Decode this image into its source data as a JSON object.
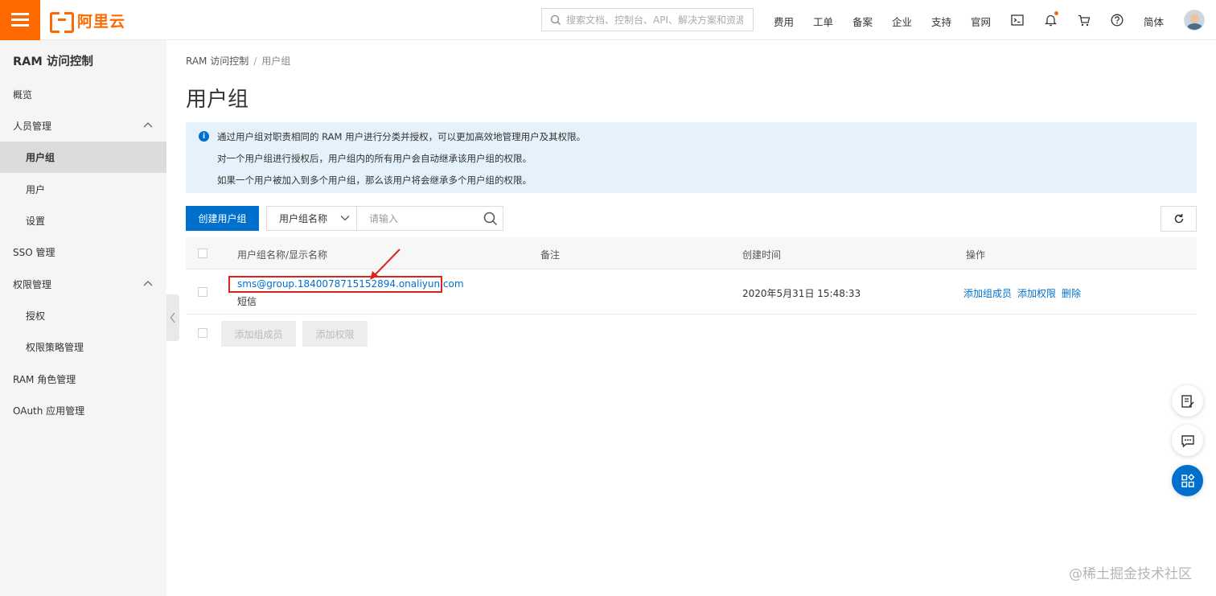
{
  "topbar": {
    "logo_text": "阿里云",
    "search_placeholder": "搜索文档、控制台、API、解决方案和资源",
    "nav": [
      "费用",
      "工单",
      "备案",
      "企业",
      "支持",
      "官网"
    ],
    "language": "简体",
    "accent_color": "#ff6a00"
  },
  "sidebar": {
    "title": "RAM 访问控制",
    "items": [
      {
        "label": "概览"
      },
      {
        "label": "人员管理"
      },
      {
        "label": "用户组"
      },
      {
        "label": "用户"
      },
      {
        "label": "设置"
      },
      {
        "label": "SSO 管理"
      },
      {
        "label": "权限管理"
      },
      {
        "label": "授权"
      },
      {
        "label": "权限策略管理"
      },
      {
        "label": "RAM 角色管理"
      },
      {
        "label": "OAuth 应用管理"
      }
    ]
  },
  "breadcrumb": {
    "root": "RAM 访问控制",
    "sep": "/",
    "current": "用户组"
  },
  "page_title": "用户组",
  "notice": {
    "lines": [
      "通过用户组对职责相同的 RAM 用户进行分类并授权，可以更加高效地管理用户及其权限。",
      "对一个用户组进行授权后，用户组内的所有用户会自动继承该用户组的权限。",
      "如果一个用户被加入到多个用户组，那么该用户将会继承多个用户组的权限。"
    ]
  },
  "toolbar": {
    "create_label": "创建用户组",
    "filter_field": "用户组名称",
    "filter_placeholder": "请输入"
  },
  "table": {
    "columns": [
      "用户组名称/显示名称",
      "备注",
      "创建时间",
      "操作"
    ],
    "rows": [
      {
        "name": "sms@group.1840078715152894.onaliyun.com",
        "display_name": "短信",
        "remark": "",
        "created": "2020年5月31日 15:48:33",
        "actions": [
          "添加组成员",
          "添加权限",
          "删除"
        ]
      }
    ],
    "batch_actions": [
      "添加组成员",
      "添加权限"
    ]
  },
  "watermark": "@稀土掘金技术社区",
  "colors": {
    "primary": "#0070cc",
    "notice_bg": "#e6f2fb",
    "highlight": "#d9261c"
  }
}
